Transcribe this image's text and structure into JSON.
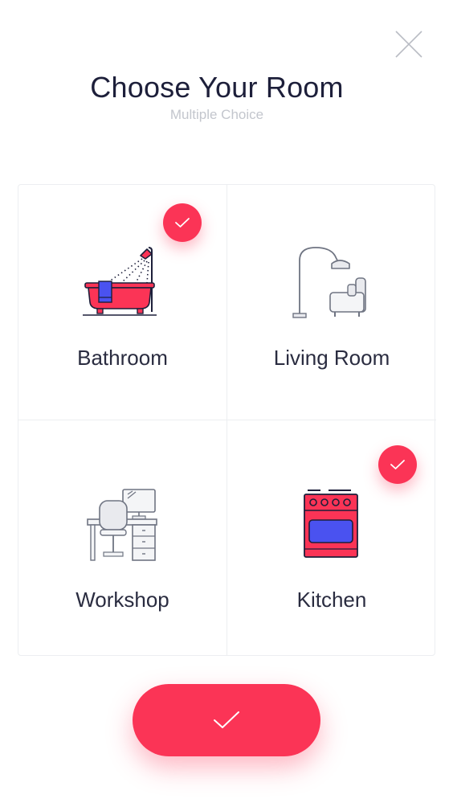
{
  "header": {
    "title": "Choose Your Room",
    "subtitle": "Multiple Choice"
  },
  "close_icon": "close-icon",
  "rooms": [
    {
      "label": "Bathroom",
      "icon": "bathtub-icon",
      "selected": true
    },
    {
      "label": "Living Room",
      "icon": "floor-lamp-armchair-icon",
      "selected": false
    },
    {
      "label": "Workshop",
      "icon": "desk-computer-icon",
      "selected": false
    },
    {
      "label": "Kitchen",
      "icon": "stove-oven-icon",
      "selected": true
    }
  ],
  "confirm_icon": "checkmark-icon",
  "colors": {
    "accent": "#fb3456",
    "blue": "#4a52f0",
    "text": "#1d1f3a",
    "muted": "#c3c6cd"
  }
}
